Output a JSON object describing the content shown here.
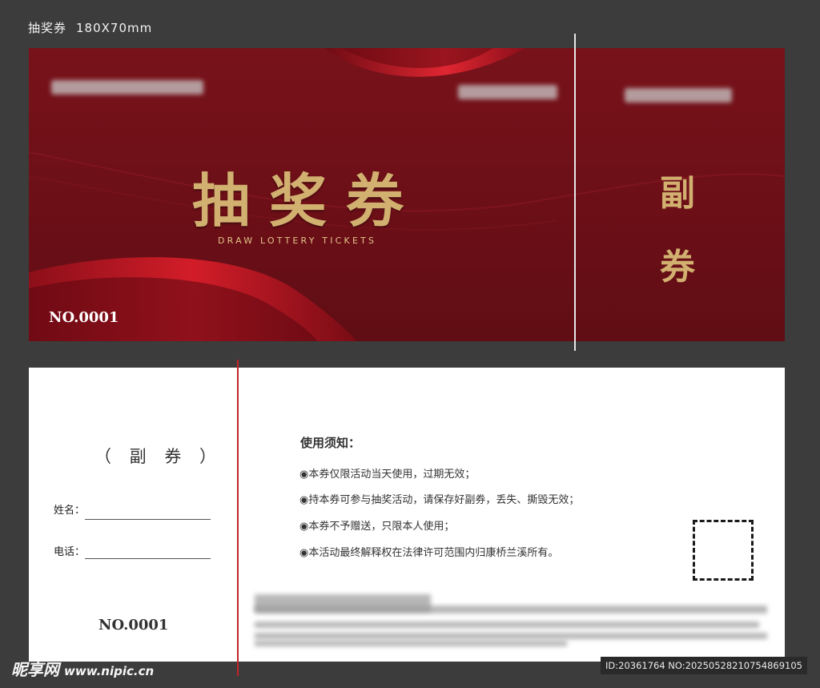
{
  "spec": {
    "name": "抽奖券",
    "size": "180X70mm"
  },
  "front": {
    "title": "抽奖券",
    "subtitle": "DRAW LOTTERY TICKETS",
    "number": "NO.0001",
    "stub_char1": "副",
    "stub_char2": "券"
  },
  "back": {
    "stub_heading": "（ 副 券 ）",
    "name_label": "姓名：",
    "phone_label": "电话：",
    "number": "NO.0001",
    "notice_title": "使用须知：",
    "rules": [
      "◉本券仅限活动当天使用，过期无效；",
      "◉持本券可参与抽奖活动，请保存好副券，丢失、撕毁无效；",
      "◉本券不予赠送，只限本人使用；",
      "◉本活动最终解释权在法律许可范围内归康桥兰溪所有。"
    ]
  },
  "watermark": {
    "logo": "昵享网",
    "url": "www.nipic.cn",
    "id": "ID:20361764 NO:20250528210754869105"
  },
  "colors": {
    "ticket_red": "#6c0f17",
    "gold": "#d1b070",
    "perforation_red": "#c2242d",
    "background": "#3b3c3b"
  }
}
